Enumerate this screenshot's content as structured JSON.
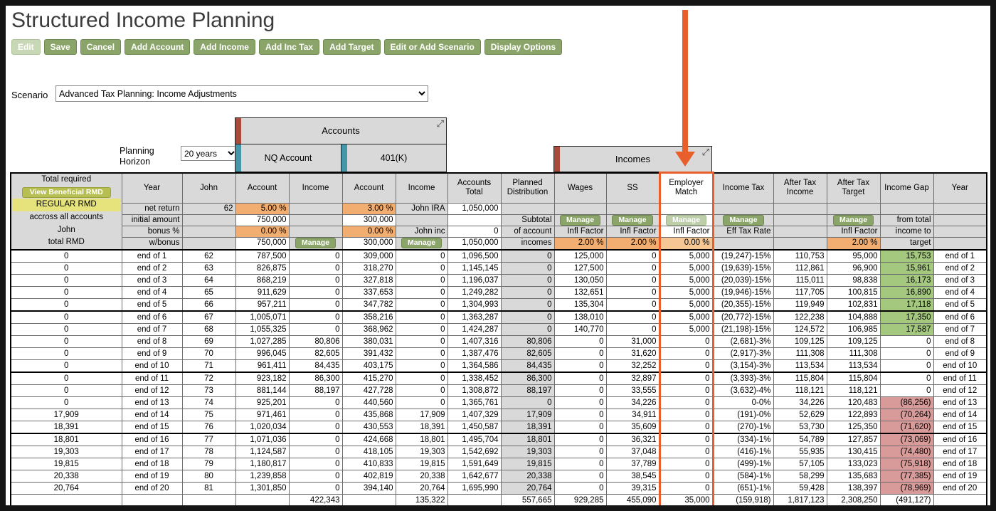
{
  "page_title": "Structured Income Planning",
  "toolbar": {
    "buttons": [
      "Edit",
      "Save",
      "Cancel",
      "Add Account",
      "Add Income",
      "Add Inc Tax",
      "Add Target",
      "Edit or Add Scenario",
      "Display Options"
    ]
  },
  "scenario": {
    "label": "Scenario",
    "value": "Advanced Tax Planning: Income Adjustments"
  },
  "planning_horizon": {
    "label": "Planning Horizon",
    "value": "20 years"
  },
  "panels": {
    "accounts": {
      "title": "Accounts",
      "expand_icon": "⤢",
      "columns": [
        "NQ Account",
        "401(K)"
      ]
    },
    "incomes": {
      "title": "Incomes",
      "expand_icon": "⤢"
    }
  },
  "colors": {
    "highlight_orange": "#e85f2c",
    "button_green": "#8ba46a",
    "gap_green": "#a4c87d",
    "gap_red": "#d89b99",
    "percent_orange": "#f2ae70",
    "header_gray": "#d9d9d9",
    "rmd_yellow": "#e6e37c",
    "accounts_accent_red": "#ac4a3c",
    "accounts_accent_teal": "#4596a9"
  },
  "table": {
    "headers": [
      "Total required",
      "Year",
      "John",
      "Account",
      "Income",
      "Account",
      "Income",
      "Accounts Total",
      "Planned Distribution",
      "Wages",
      "SS",
      "Employer Match",
      "Income Tax",
      "After Tax Income",
      "After Tax Target",
      "Income Gap",
      "Year"
    ],
    "left_panel": {
      "button": "View Beneficial RMD",
      "line1": "REGULAR RMD",
      "line2": "accross all accounts",
      "line3": "John",
      "line4": "total RMD"
    },
    "subheader": {
      "row_labels": [
        "net return",
        "initial amount",
        "bonus %",
        "w/bonus"
      ],
      "john_age": "62",
      "nq_account": {
        "net_return": "5.00 %",
        "initial": "750,000",
        "bonus": "0.00 %",
        "wbonus": "750,000"
      },
      "nq_income": {
        "manage": "Manage"
      },
      "k_account": {
        "net_return": "3.00 %",
        "initial": "300,000",
        "bonus": "0.00 %",
        "wbonus": "300,000"
      },
      "k_income": {
        "name": "John IRA",
        "name2": "John inc",
        "manage": "Manage"
      },
      "accounts_total": {
        "r1": "1,050,000",
        "r3": "0",
        "r4": "1,050,000"
      },
      "planned": {
        "r2": "Subtotal",
        "r3": "of account",
        "r4": "incomes"
      },
      "wages": {
        "manage": "Manage",
        "infl": "Infl Factor",
        "pct": "2.00 %"
      },
      "ss": {
        "manage": "Manage",
        "infl": "Infl Factor",
        "pct": "2.00 %"
      },
      "match": {
        "manage": "Manage",
        "infl": "Infl Factor",
        "pct": "0.00 %"
      },
      "tax": {
        "manage": "Manage",
        "label": "Eff Tax Rate"
      },
      "att": {
        "manage": "Manage",
        "infl": "Infl Factor",
        "pct": "2.00 %"
      },
      "gap": {
        "r2": "from total",
        "r3": "income to",
        "r4": "target"
      }
    },
    "rows": [
      [
        "0",
        "end of 1",
        "62",
        "787,500",
        "0",
        "309,000",
        "0",
        "1,096,500",
        "0",
        "125,000",
        "0",
        "5,000",
        "(19,247)-15%",
        "110,753",
        "95,000",
        "15,753",
        "end of 1"
      ],
      [
        "0",
        "end of 2",
        "63",
        "826,875",
        "0",
        "318,270",
        "0",
        "1,145,145",
        "0",
        "127,500",
        "0",
        "5,000",
        "(19,639)-15%",
        "112,861",
        "96,900",
        "15,961",
        "end of 2"
      ],
      [
        "0",
        "end of 3",
        "64",
        "868,219",
        "0",
        "327,818",
        "0",
        "1,196,037",
        "0",
        "130,050",
        "0",
        "5,000",
        "(20,039)-15%",
        "115,011",
        "98,838",
        "16,173",
        "end of 3"
      ],
      [
        "0",
        "end of 4",
        "65",
        "911,629",
        "0",
        "337,653",
        "0",
        "1,249,282",
        "0",
        "132,651",
        "0",
        "5,000",
        "(19,946)-15%",
        "117,705",
        "100,815",
        "16,890",
        "end of 4"
      ],
      [
        "0",
        "end of 5",
        "66",
        "957,211",
        "0",
        "347,782",
        "0",
        "1,304,993",
        "0",
        "135,304",
        "0",
        "5,000",
        "(20,355)-15%",
        "119,949",
        "102,831",
        "17,118",
        "end of 5"
      ],
      [
        "0",
        "end of 6",
        "67",
        "1,005,071",
        "0",
        "358,216",
        "0",
        "1,363,287",
        "0",
        "138,010",
        "0",
        "5,000",
        "(20,772)-15%",
        "122,238",
        "104,888",
        "17,350",
        "end of 6"
      ],
      [
        "0",
        "end of 7",
        "68",
        "1,055,325",
        "0",
        "368,962",
        "0",
        "1,424,287",
        "0",
        "140,770",
        "0",
        "5,000",
        "(21,198)-15%",
        "124,572",
        "106,985",
        "17,587",
        "end of 7"
      ],
      [
        "0",
        "end of 8",
        "69",
        "1,027,285",
        "80,806",
        "380,031",
        "0",
        "1,407,316",
        "80,806",
        "0",
        "31,000",
        "0",
        "(2,681)-3%",
        "109,125",
        "109,125",
        "0",
        "end of 8"
      ],
      [
        "0",
        "end of 9",
        "70",
        "996,045",
        "82,605",
        "391,432",
        "0",
        "1,387,476",
        "82,605",
        "0",
        "31,620",
        "0",
        "(2,917)-3%",
        "111,308",
        "111,308",
        "0",
        "end of 9"
      ],
      [
        "0",
        "end of 10",
        "71",
        "961,411",
        "84,435",
        "403,175",
        "0",
        "1,364,586",
        "84,435",
        "0",
        "32,252",
        "0",
        "(3,154)-3%",
        "113,534",
        "113,534",
        "0",
        "end of 10"
      ],
      [
        "0",
        "end of 11",
        "72",
        "923,182",
        "86,300",
        "415,270",
        "0",
        "1,338,452",
        "86,300",
        "0",
        "32,897",
        "0",
        "(3,393)-3%",
        "115,804",
        "115,804",
        "0",
        "end of 11"
      ],
      [
        "0",
        "end of 12",
        "73",
        "881,144",
        "88,197",
        "427,728",
        "0",
        "1,308,872",
        "88,197",
        "0",
        "33,555",
        "0",
        "(3,632)-4%",
        "118,121",
        "118,121",
        "0",
        "end of 12"
      ],
      [
        "0",
        "end of 13",
        "74",
        "925,201",
        "0",
        "440,560",
        "0",
        "1,365,761",
        "0",
        "0",
        "34,226",
        "0",
        "0-0%",
        "34,226",
        "120,483",
        "(86,256)",
        "end of 13"
      ],
      [
        "17,909",
        "end of 14",
        "75",
        "971,461",
        "0",
        "435,868",
        "17,909",
        "1,407,329",
        "17,909",
        "0",
        "34,911",
        "0",
        "(191)-0%",
        "52,629",
        "122,893",
        "(70,264)",
        "end of 14"
      ],
      [
        "18,391",
        "end of 15",
        "76",
        "1,020,034",
        "0",
        "430,553",
        "18,391",
        "1,450,587",
        "18,391",
        "0",
        "35,609",
        "0",
        "(270)-1%",
        "53,730",
        "125,350",
        "(71,620)",
        "end of 15"
      ],
      [
        "18,801",
        "end of 16",
        "77",
        "1,071,036",
        "0",
        "424,668",
        "18,801",
        "1,495,704",
        "18,801",
        "0",
        "36,321",
        "0",
        "(334)-1%",
        "54,789",
        "127,857",
        "(73,069)",
        "end of 16"
      ],
      [
        "19,303",
        "end of 17",
        "78",
        "1,124,587",
        "0",
        "418,105",
        "19,303",
        "1,542,692",
        "19,303",
        "0",
        "37,048",
        "0",
        "(416)-1%",
        "55,935",
        "130,415",
        "(74,480)",
        "end of 17"
      ],
      [
        "19,815",
        "end of 18",
        "79",
        "1,180,817",
        "0",
        "410,833",
        "19,815",
        "1,591,649",
        "19,815",
        "0",
        "37,789",
        "0",
        "(499)-1%",
        "57,105",
        "133,023",
        "(75,918)",
        "end of 18"
      ],
      [
        "20,338",
        "end of 19",
        "80",
        "1,239,858",
        "0",
        "402,819",
        "20,338",
        "1,642,677",
        "20,338",
        "0",
        "38,545",
        "0",
        "(584)-1%",
        "58,299",
        "135,683",
        "(77,385)",
        "end of 19"
      ],
      [
        "20,764",
        "end of 20",
        "81",
        "1,301,850",
        "0",
        "394,140",
        "20,764",
        "1,695,990",
        "20,764",
        "0",
        "39,315",
        "0",
        "(651)-1%",
        "59,428",
        "138,397",
        "(78,969)",
        "end of 20"
      ]
    ],
    "totals": [
      "",
      "",
      "",
      "",
      "422,343",
      "",
      "135,322",
      "",
      "557,665",
      "929,285",
      "455,090",
      "35,000",
      "(159,918)",
      "1,817,123",
      "2,308,250",
      "(491,127)",
      ""
    ]
  }
}
